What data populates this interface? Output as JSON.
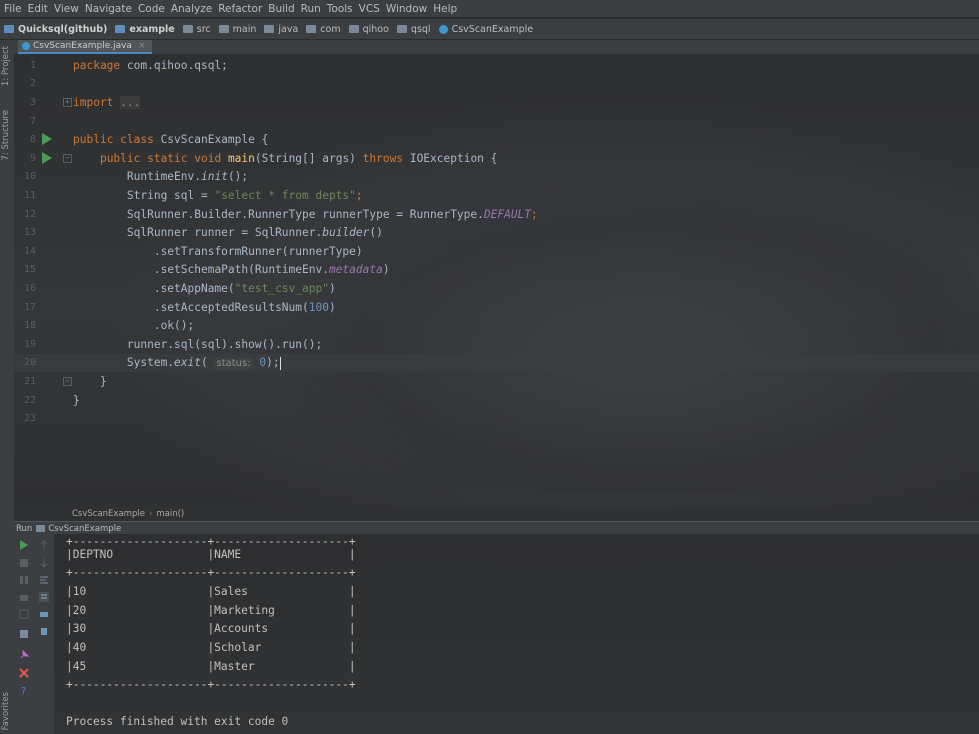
{
  "menu": [
    "File",
    "Edit",
    "View",
    "Navigate",
    "Code",
    "Analyze",
    "Refactor",
    "Build",
    "Run",
    "Tools",
    "VCS",
    "Window",
    "Help"
  ],
  "nav": {
    "project": "Quicksql(github)",
    "crumbs": [
      "example",
      "src",
      "main",
      "java",
      "com",
      "qihoo",
      "qsql",
      "CsvScanExample"
    ]
  },
  "side_tabs": {
    "project": "1: Project",
    "structure": "7: Structure",
    "favorites": "Favorites"
  },
  "file_tab": {
    "name": "CsvScanExample.java"
  },
  "code": {
    "l1_kw": "package ",
    "l1_rest": "com.qihoo.qsql;",
    "l3_kw": "import ",
    "l3_rest": "...",
    "l8_kw": "public class ",
    "l8_rest": "CsvScanExample {",
    "l9_kw1": "public static void ",
    "l9_fn": "main",
    "l9_mid": "(String[] args) ",
    "l9_kw2": "throws ",
    "l9_rest": "IOException {",
    "l10_a": "RuntimeEnv.",
    "l10_b": "init",
    "l10_c": "();",
    "l11_a": "String sql = ",
    "l11_str": "\"select * from depts\"",
    "l11_c": ";",
    "l12_a": "SqlRunner.Builder.RunnerType runnerType = RunnerType.",
    "l12_b": "DEFAULT",
    "l12_c": ";",
    "l13_a": "SqlRunner runner = SqlRunner.",
    "l13_b": "builder",
    "l13_c": "()",
    "l14": ".setTransformRunner(runnerType)",
    "l15_a": ".setSchemaPath(RuntimeEnv.",
    "l15_b": "metadata",
    "l15_c": ")",
    "l16_a": ".setAppName(",
    "l16_str": "\"test_csv_app\"",
    "l16_c": ")",
    "l17_a": ".setAcceptedResultsNum(",
    "l17_num": "100",
    "l17_c": ")",
    "l18": ".ok();",
    "l19": "runner.sql(sql).show().run();",
    "l20_a": "System.",
    "l20_b": "exit",
    "l20_hint": "status:",
    "l20_num": "0",
    "l20_c": ");",
    "l21": "}",
    "l22": "}"
  },
  "line_numbers": [
    "1",
    "2",
    "3",
    "7",
    "8",
    "9",
    "10",
    "11",
    "12",
    "13",
    "14",
    "15",
    "16",
    "17",
    "18",
    "19",
    "20",
    "21",
    "22",
    "23"
  ],
  "breadcrumb": {
    "cls": "CsvScanExample",
    "method": "main()"
  },
  "run": {
    "label": "Run",
    "config": "CsvScanExample"
  },
  "console": {
    "header": "|DEPTNO              |NAME                |",
    "divider": "+--------------------+--------------------+",
    "rows": [
      "|10                  |Sales               |",
      "|20                  |Marketing           |",
      "|30                  |Accounts            |",
      "|40                  |Scholar             |",
      "|45                  |Master              |"
    ],
    "finish": "Process finished with exit code 0"
  },
  "colors": {
    "keyword": "#cc7832",
    "string": "#6a8759",
    "number": "#6897bb",
    "static": "#9876aa",
    "run_green": "#499c54"
  }
}
